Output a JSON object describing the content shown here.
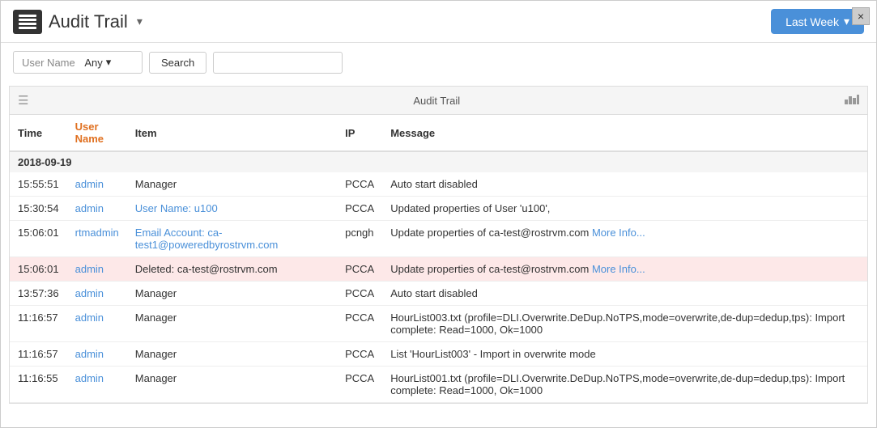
{
  "header": {
    "title": "Audit Trail",
    "caret": "▾",
    "close_label": "×"
  },
  "filter_button": {
    "last_week_label": "Last Week",
    "caret": "▾"
  },
  "filter": {
    "user_name_label": "User Name",
    "user_name_value": "Any",
    "caret": "▾",
    "search_label": "Search",
    "search_placeholder": ""
  },
  "grid": {
    "panel_title": "Audit Trail",
    "columns": [
      {
        "key": "time",
        "label": "Time"
      },
      {
        "key": "username",
        "label": "User Name"
      },
      {
        "key": "item",
        "label": "Item"
      },
      {
        "key": "ip",
        "label": "IP"
      },
      {
        "key": "message",
        "label": "Message"
      }
    ],
    "date_group": "2018-09-19",
    "rows": [
      {
        "time": "15:55:51",
        "username": "admin",
        "item": "Manager",
        "item_link": false,
        "ip": "PCCA",
        "message": "Auto start disabled",
        "highlighted": false
      },
      {
        "time": "15:30:54",
        "username": "admin",
        "item": "User Name: u100",
        "item_link": true,
        "ip": "PCCA",
        "message": "Updated properties of User 'u100',",
        "highlighted": false
      },
      {
        "time": "15:06:01",
        "username": "rtmadmin",
        "item": "Email Account: ca-test1@poweredbyrostrvm.com",
        "item_link": true,
        "ip": "pcngh",
        "message": "Update properties of ca-test@rostrvm.com More Info...",
        "message_link_text": "More Info...",
        "highlighted": false
      },
      {
        "time": "15:06:01",
        "username": "admin",
        "item": "Deleted: ca-test@rostrvm.com",
        "item_link": false,
        "item_deleted": true,
        "ip": "PCCA",
        "message": "Update properties of ca-test@rostrvm.com More Info...",
        "message_link_text": "More Info...",
        "highlighted": true
      },
      {
        "time": "13:57:36",
        "username": "admin",
        "item": "Manager",
        "item_link": false,
        "ip": "PCCA",
        "message": "Auto start disabled",
        "highlighted": false
      },
      {
        "time": "11:16:57",
        "username": "admin",
        "item": "Manager",
        "item_link": false,
        "ip": "PCCA",
        "message": "HourList003.txt (profile=DLI.Overwrite.DeDup.NoTPS,mode=overwrite,de-dup=dedup,tps): Import complete: Read=1000, Ok=1000",
        "highlighted": false
      },
      {
        "time": "11:16:57",
        "username": "admin",
        "item": "Manager",
        "item_link": false,
        "ip": "PCCA",
        "message": "List 'HourList003' - Import in overwrite mode",
        "highlighted": false
      },
      {
        "time": "11:16:55",
        "username": "admin",
        "item": "Manager",
        "item_link": false,
        "ip": "PCCA",
        "message": "HourList001.txt (profile=DLI.Overwrite.DeDup.NoTPS,mode=overwrite,de-dup=dedup,tps): Import complete: Read=1000, Ok=1000",
        "highlighted": false
      }
    ]
  }
}
